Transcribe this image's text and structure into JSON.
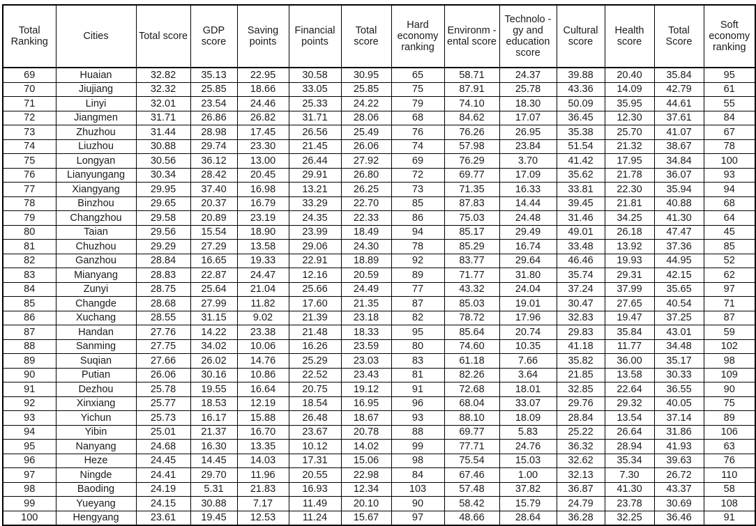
{
  "table": {
    "headers": [
      "Total Ranking",
      "Cities",
      "Total score",
      "GDP score",
      "Saving points",
      "Financial points",
      "Total score",
      "Hard economy ranking",
      "Environm -ental score",
      "Technolo -gy and education score",
      "Cultural score",
      "Health score",
      "Total Score",
      "Soft economy ranking"
    ],
    "rows": [
      [
        "69",
        "Huaian",
        "32.82",
        "35.13",
        "22.95",
        "30.58",
        "30.95",
        "65",
        "58.71",
        "24.37",
        "39.88",
        "20.40",
        "35.84",
        "95"
      ],
      [
        "70",
        "Jiujiang",
        "32.32",
        "25.85",
        "18.66",
        "33.05",
        "25.85",
        "75",
        "87.91",
        "25.78",
        "43.36",
        "14.09",
        "42.79",
        "61"
      ],
      [
        "71",
        "Linyi",
        "32.01",
        "23.54",
        "24.46",
        "25.33",
        "24.22",
        "79",
        "74.10",
        "18.30",
        "50.09",
        "35.95",
        "44.61",
        "55"
      ],
      [
        "72",
        "Jiangmen",
        "31.71",
        "26.86",
        "26.82",
        "31.71",
        "28.06",
        "68",
        "84.62",
        "17.07",
        "36.45",
        "12.30",
        "37.61",
        "84"
      ],
      [
        "73",
        "Zhuzhou",
        "31.44",
        "28.98",
        "17.45",
        "26.56",
        "25.49",
        "76",
        "76.26",
        "26.95",
        "35.38",
        "25.70",
        "41.07",
        "67"
      ],
      [
        "74",
        "Liuzhou",
        "30.88",
        "29.74",
        "23.30",
        "21.45",
        "26.06",
        "74",
        "57.98",
        "23.84",
        "51.54",
        "21.32",
        "38.67",
        "78"
      ],
      [
        "75",
        "Longyan",
        "30.56",
        "36.12",
        "13.00",
        "26.44",
        "27.92",
        "69",
        "76.29",
        "3.70",
        "41.42",
        "17.95",
        "34.84",
        "100"
      ],
      [
        "76",
        "Lianyungang",
        "30.34",
        "28.42",
        "20.45",
        "29.91",
        "26.80",
        "72",
        "69.77",
        "17.09",
        "35.62",
        "21.78",
        "36.07",
        "93"
      ],
      [
        "77",
        "Xiangyang",
        "29.95",
        "37.40",
        "16.98",
        "13.21",
        "26.25",
        "73",
        "71.35",
        "16.33",
        "33.81",
        "22.30",
        "35.94",
        "94"
      ],
      [
        "78",
        "Binzhou",
        "29.65",
        "20.37",
        "16.79",
        "33.29",
        "22.70",
        "85",
        "87.83",
        "14.44",
        "39.45",
        "21.81",
        "40.88",
        "68"
      ],
      [
        "79",
        "Changzhou",
        "29.58",
        "20.89",
        "23.19",
        "24.35",
        "22.33",
        "86",
        "75.03",
        "24.48",
        "31.46",
        "34.25",
        "41.30",
        "64"
      ],
      [
        "80",
        "Taian",
        "29.56",
        "15.54",
        "18.90",
        "23.99",
        "18.49",
        "94",
        "85.17",
        "29.49",
        "49.01",
        "26.18",
        "47.47",
        "45"
      ],
      [
        "81",
        "Chuzhou",
        "29.29",
        "27.29",
        "13.58",
        "29.06",
        "24.30",
        "78",
        "85.29",
        "16.74",
        "33.48",
        "13.92",
        "37.36",
        "85"
      ],
      [
        "82",
        "Ganzhou",
        "28.84",
        "16.65",
        "19.33",
        "22.91",
        "18.89",
        "92",
        "83.77",
        "29.64",
        "46.46",
        "19.93",
        "44.95",
        "52"
      ],
      [
        "83",
        "Mianyang",
        "28.83",
        "22.87",
        "24.47",
        "12.16",
        "20.59",
        "89",
        "71.77",
        "31.80",
        "35.74",
        "29.31",
        "42.15",
        "62"
      ],
      [
        "84",
        "Zunyi",
        "28.75",
        "25.64",
        "21.04",
        "25.66",
        "24.49",
        "77",
        "43.32",
        "24.04",
        "37.24",
        "37.99",
        "35.65",
        "97"
      ],
      [
        "85",
        "Changde",
        "28.68",
        "27.99",
        "11.82",
        "17.60",
        "21.35",
        "87",
        "85.03",
        "19.01",
        "30.47",
        "27.65",
        "40.54",
        "71"
      ],
      [
        "86",
        "Xuchang",
        "28.55",
        "31.15",
        "9.02",
        "21.39",
        "23.18",
        "82",
        "78.72",
        "17.96",
        "32.83",
        "19.47",
        "37.25",
        "87"
      ],
      [
        "87",
        "Handan",
        "27.76",
        "14.22",
        "23.38",
        "21.48",
        "18.33",
        "95",
        "85.64",
        "20.74",
        "29.83",
        "35.84",
        "43.01",
        "59"
      ],
      [
        "88",
        "Sanming",
        "27.75",
        "34.02",
        "10.06",
        "16.26",
        "23.59",
        "80",
        "74.60",
        "10.35",
        "41.18",
        "11.77",
        "34.48",
        "102"
      ],
      [
        "89",
        "Suqian",
        "27.66",
        "26.02",
        "14.76",
        "25.29",
        "23.03",
        "83",
        "61.18",
        "7.66",
        "35.82",
        "36.00",
        "35.17",
        "98"
      ],
      [
        "90",
        "Putian",
        "26.06",
        "30.16",
        "10.86",
        "22.52",
        "23.43",
        "81",
        "82.26",
        "3.64",
        "21.85",
        "13.58",
        "30.33",
        "109"
      ],
      [
        "91",
        "Dezhou",
        "25.78",
        "19.55",
        "16.64",
        "20.75",
        "19.12",
        "91",
        "72.68",
        "18.01",
        "32.85",
        "22.64",
        "36.55",
        "90"
      ],
      [
        "92",
        "Xinxiang",
        "25.77",
        "18.53",
        "12.19",
        "18.54",
        "16.95",
        "96",
        "68.04",
        "33.07",
        "29.76",
        "29.32",
        "40.05",
        "75"
      ],
      [
        "93",
        "Yichun",
        "25.73",
        "16.17",
        "15.88",
        "26.48",
        "18.67",
        "93",
        "88.10",
        "18.09",
        "28.84",
        "13.54",
        "37.14",
        "89"
      ],
      [
        "94",
        "Yibin",
        "25.01",
        "21.37",
        "16.70",
        "23.67",
        "20.78",
        "88",
        "69.77",
        "5.83",
        "25.22",
        "26.64",
        "31.86",
        "106"
      ],
      [
        "95",
        "Nanyang",
        "24.68",
        "16.30",
        "13.35",
        "10.12",
        "14.02",
        "99",
        "77.71",
        "24.76",
        "36.32",
        "28.94",
        "41.93",
        "63"
      ],
      [
        "96",
        "Heze",
        "24.45",
        "14.45",
        "14.03",
        "17.31",
        "15.06",
        "98",
        "75.54",
        "15.03",
        "32.62",
        "35.34",
        "39.63",
        "76"
      ],
      [
        "97",
        "Ningde",
        "24.41",
        "29.70",
        "11.96",
        "20.55",
        "22.98",
        "84",
        "67.46",
        "1.00",
        "32.13",
        "7.30",
        "26.72",
        "110"
      ],
      [
        "98",
        "Baoding",
        "24.19",
        "5.31",
        "21.83",
        "16.93",
        "12.34",
        "103",
        "57.48",
        "37.82",
        "36.87",
        "41.30",
        "43.37",
        "58"
      ],
      [
        "99",
        "Yueyang",
        "24.15",
        "30.88",
        "7.17",
        "11.49",
        "20.10",
        "90",
        "58.42",
        "15.79",
        "24.79",
        "23.78",
        "30.69",
        "108"
      ],
      [
        "100",
        "Hengyang",
        "23.61",
        "19.45",
        "12.53",
        "11.24",
        "15.67",
        "97",
        "48.66",
        "28.64",
        "36.28",
        "32.25",
        "36.46",
        "91"
      ]
    ]
  }
}
